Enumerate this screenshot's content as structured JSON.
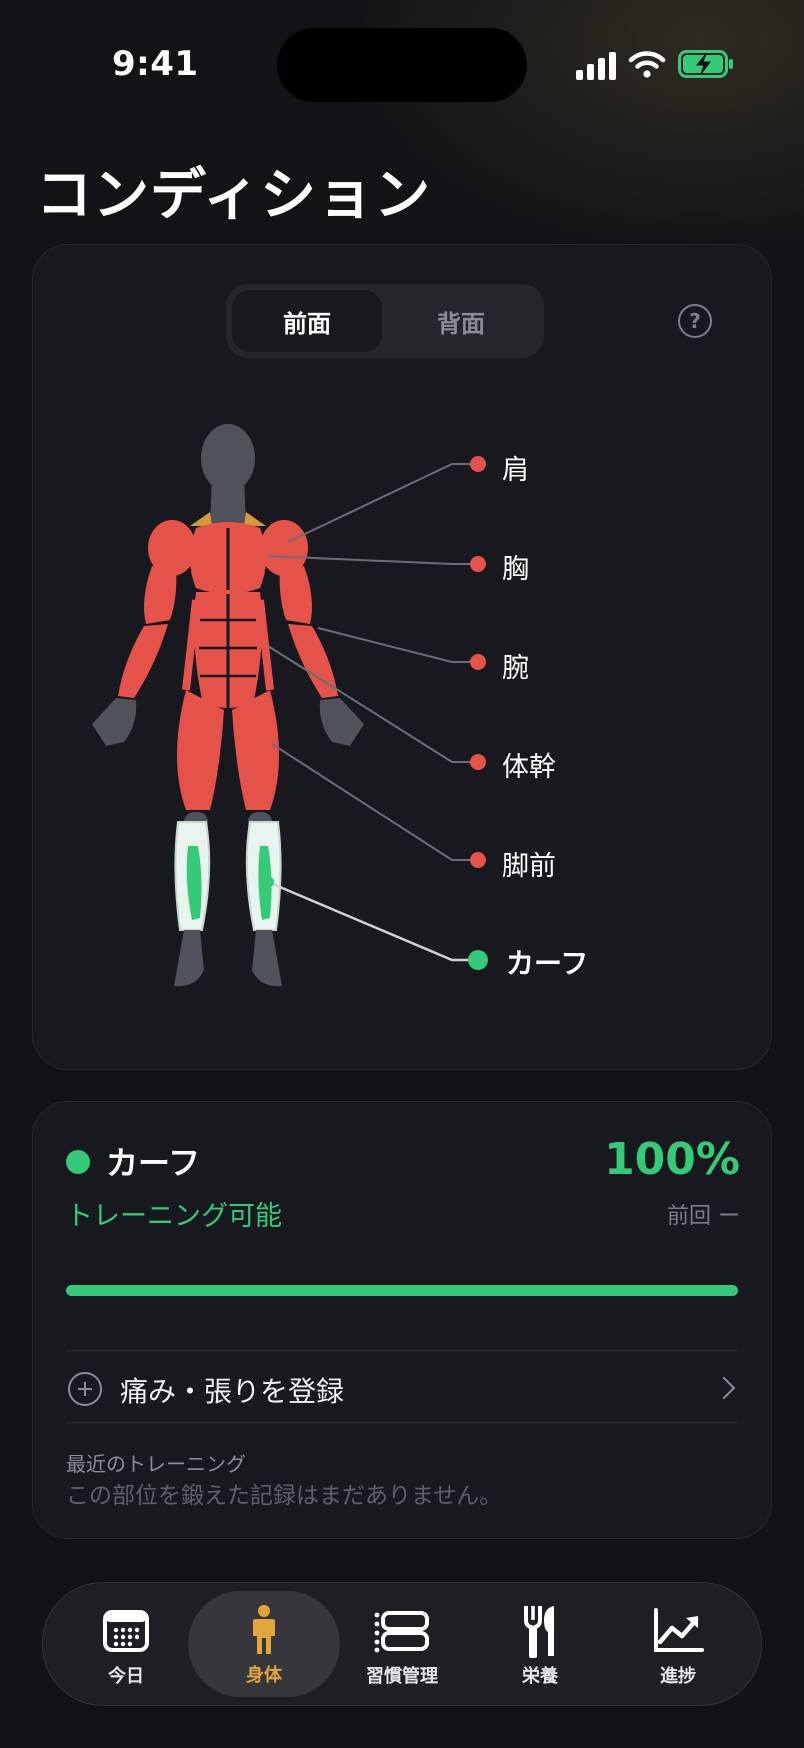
{
  "status_bar": {
    "time": "9:41"
  },
  "page": {
    "title": "コンディション"
  },
  "view_toggle": {
    "options": [
      "前面",
      "背面"
    ],
    "selected": "前面"
  },
  "help": {
    "icon": "question-circle-icon",
    "label": "?"
  },
  "body_parts": [
    {
      "label": "肩",
      "color": "#e5524a",
      "selected": false
    },
    {
      "label": "胸",
      "color": "#e5524a",
      "selected": false
    },
    {
      "label": "腕",
      "color": "#e5524a",
      "selected": false
    },
    {
      "label": "体幹",
      "color": "#e5524a",
      "selected": false
    },
    {
      "label": "脚前",
      "color": "#e5524a",
      "selected": false
    },
    {
      "label": "カーフ",
      "color": "#35c97a",
      "selected": true
    }
  ],
  "detail": {
    "name": "カーフ",
    "percent": "100%",
    "recovery_fraction": 1.0,
    "status": "トレーニング可能",
    "previous": "前回 ー",
    "register_label": "痛み・張りを登録",
    "recent_heading": "最近のトレーニング",
    "recent_empty": "この部位を鍛えた記録はまだありません。"
  },
  "tabs": [
    {
      "label": "今日",
      "icon": "calendar-icon",
      "active": false
    },
    {
      "label": "身体",
      "icon": "person-icon",
      "active": true
    },
    {
      "label": "習慣管理",
      "icon": "habit-list-icon",
      "active": false
    },
    {
      "label": "栄養",
      "icon": "fork-knife-icon",
      "active": false
    },
    {
      "label": "進捗",
      "icon": "chart-up-icon",
      "active": false
    }
  ],
  "colors": {
    "accent_green": "#35c97a",
    "muscle_red": "#e5524a",
    "tab_active": "#e3a63d"
  }
}
